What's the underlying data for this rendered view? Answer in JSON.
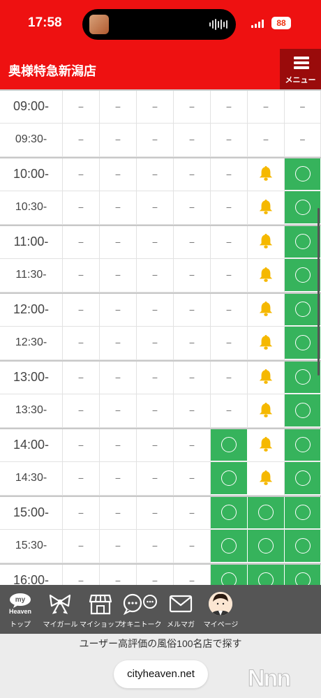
{
  "status_bar": {
    "time": "17:58",
    "battery": "88"
  },
  "header": {
    "shop_name": "奥様特急新潟店",
    "menu_label": "メニュー"
  },
  "colors": {
    "brand_red": "#ee1111",
    "available_green": "#36b35c",
    "bell_yellow": "#f5b800"
  },
  "schedule": {
    "legend_symbols": {
      "dash": "−",
      "available": "circle-icon",
      "bell": "bell-icon"
    },
    "rows": [
      {
        "time": "09:00-",
        "cells": [
          "−",
          "−",
          "−",
          "−",
          "−",
          "−",
          "−"
        ]
      },
      {
        "time": "09:30-",
        "cells": [
          "−",
          "−",
          "−",
          "−",
          "−",
          "−",
          "−"
        ]
      },
      {
        "time": "10:00-",
        "cells": [
          "−",
          "−",
          "−",
          "−",
          "−",
          "bell",
          "avail"
        ]
      },
      {
        "time": "10:30-",
        "cells": [
          "−",
          "−",
          "−",
          "−",
          "−",
          "bell",
          "avail"
        ]
      },
      {
        "time": "11:00-",
        "cells": [
          "−",
          "−",
          "−",
          "−",
          "−",
          "bell",
          "avail"
        ]
      },
      {
        "time": "11:30-",
        "cells": [
          "−",
          "−",
          "−",
          "−",
          "−",
          "bell",
          "avail"
        ]
      },
      {
        "time": "12:00-",
        "cells": [
          "−",
          "−",
          "−",
          "−",
          "−",
          "bell",
          "avail"
        ]
      },
      {
        "time": "12:30-",
        "cells": [
          "−",
          "−",
          "−",
          "−",
          "−",
          "bell",
          "avail"
        ]
      },
      {
        "time": "13:00-",
        "cells": [
          "−",
          "−",
          "−",
          "−",
          "−",
          "bell",
          "avail"
        ]
      },
      {
        "time": "13:30-",
        "cells": [
          "−",
          "−",
          "−",
          "−",
          "−",
          "bell",
          "avail"
        ]
      },
      {
        "time": "14:00-",
        "cells": [
          "−",
          "−",
          "−",
          "−",
          "avail",
          "bell",
          "avail"
        ]
      },
      {
        "time": "14:30-",
        "cells": [
          "−",
          "−",
          "−",
          "−",
          "avail",
          "bell",
          "avail"
        ]
      },
      {
        "time": "15:00-",
        "cells": [
          "−",
          "−",
          "−",
          "−",
          "avail",
          "avail",
          "avail"
        ]
      },
      {
        "time": "15:30-",
        "cells": [
          "−",
          "−",
          "−",
          "−",
          "avail",
          "avail",
          "avail"
        ]
      },
      {
        "time": "16:00-",
        "cells": [
          "−",
          "−",
          "−",
          "−",
          "avail",
          "avail",
          "avail"
        ]
      }
    ]
  },
  "tabbar": {
    "items": [
      {
        "label": "トップ",
        "icon": "my-heaven-logo-icon",
        "logo_top": "my",
        "logo_bottom": "Heaven"
      },
      {
        "label": "マイガール",
        "icon": "ribbon-icon"
      },
      {
        "label": "マイショップ",
        "icon": "shop-icon"
      },
      {
        "label": "オキニトーク",
        "icon": "chat-bubbles-icon"
      },
      {
        "label": "メルマガ",
        "icon": "mail-icon"
      },
      {
        "label": "マイページ",
        "icon": "user-avatar-icon"
      }
    ]
  },
  "footer": {
    "tagline": "ユーザー高評価の風俗100名店で探す",
    "url": "cityheaven.net",
    "watermark": "Nnn"
  }
}
